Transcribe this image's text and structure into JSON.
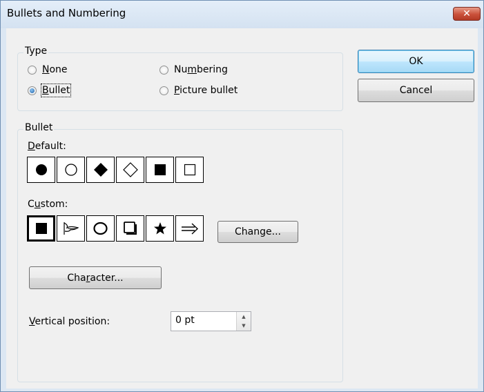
{
  "window": {
    "title": "Bullets and Numbering",
    "close_glyph": "✕"
  },
  "type_group": {
    "label": "Type",
    "options": [
      {
        "label": "None",
        "accel": "N",
        "checked": false
      },
      {
        "label": "Numbering",
        "accel": "m",
        "checked": false
      },
      {
        "label": "Bullet",
        "accel": "B",
        "checked": true
      },
      {
        "label": "Picture bullet",
        "accel": "P",
        "checked": false
      }
    ]
  },
  "buttons": {
    "ok": "OK",
    "cancel": "Cancel",
    "change": "Change...",
    "character": "Character..."
  },
  "bullet_group": {
    "label": "Bullet",
    "default_label": "Default:",
    "default_bullets": [
      "●",
      "○",
      "◆",
      "◇",
      "■",
      "□"
    ],
    "custom_label": "Custom:",
    "custom_bullets": [
      "■",
      "flag",
      "❍",
      "❑",
      "★",
      "⇒"
    ],
    "custom_selected_index": 0
  },
  "vertical_position": {
    "label": "Vertical position:",
    "value": "0 pt"
  },
  "icons": {
    "spin_up": "▲",
    "spin_down": "▼",
    "default_bullet_icons": [
      "filled-circle-icon",
      "hollow-circle-icon",
      "filled-diamond-icon",
      "hollow-diamond-icon",
      "filled-square-icon",
      "hollow-square-icon"
    ],
    "custom_bullet_icons": [
      "filled-square-icon",
      "pointing-hand-flag-icon",
      "shadow-circle-icon",
      "shadow-square-icon",
      "star-icon",
      "double-arrow-icon"
    ]
  }
}
